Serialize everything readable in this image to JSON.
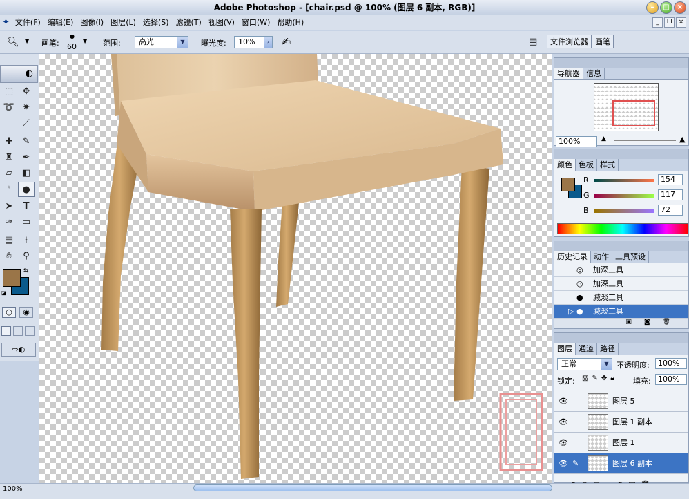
{
  "titlebar": {
    "title": "Adobe Photoshop - [chair.psd @ 100% (图层 6 副本, RGB)]"
  },
  "menu": [
    "文件(F)",
    "编辑(E)",
    "图像(I)",
    "图层(L)",
    "选择(S)",
    "滤镜(T)",
    "视图(V)",
    "窗口(W)",
    "帮助(H)"
  ],
  "options": {
    "brush_label": "画笔:",
    "brush_size": "60",
    "range_label": "范围:",
    "range_value": "高光",
    "exposure_label": "曝光度:",
    "exposure_value": "10%"
  },
  "tool_tabs": [
    "文件浏览器",
    "画笔"
  ],
  "navigator": {
    "tabs": [
      "导航器",
      "信息"
    ],
    "zoom": "100%"
  },
  "color_panel": {
    "tabs": [
      "颜色",
      "色板",
      "样式"
    ],
    "r_label": "R",
    "g_label": "G",
    "b_label": "B",
    "r": "154",
    "g": "117",
    "b": "72",
    "foreground": "#9a7548",
    "background": "#0a5a8c"
  },
  "history_panel": {
    "tabs": [
      "历史记录",
      "动作",
      "工具预设"
    ],
    "items": [
      "加深工具",
      "加深工具",
      "减淡工具",
      "减淡工具"
    ]
  },
  "layers_panel": {
    "tabs": [
      "图层",
      "通道",
      "路径"
    ],
    "blend_mode": "正常",
    "opacity_label": "不透明度:",
    "opacity": "100%",
    "lock_label": "锁定:",
    "fill_label": "填充:",
    "fill": "100%",
    "layers": [
      "图层 5",
      "图层 1 副本",
      "图层 1",
      "图层 6 副本"
    ]
  },
  "status": {
    "zoom": "100%"
  }
}
